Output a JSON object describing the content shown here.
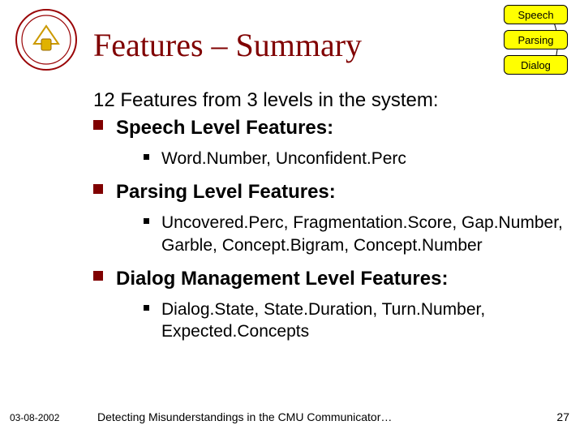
{
  "title": "Features – Summary",
  "tags": {
    "speech": "Speech",
    "parsing": "Parsing",
    "dialog": "Dialog"
  },
  "intro": "12 Features from 3 levels in the system:",
  "sections": [
    {
      "label": "Speech Level Features:",
      "items": [
        "Word.Number, Unconfident.Perc"
      ]
    },
    {
      "label": "Parsing Level Features:",
      "items": [
        "Uncovered.Perc, Fragmentation.Score, Gap.Number, Garble, Concept.Bigram, Concept.Number"
      ]
    },
    {
      "label": "Dialog Management Level Features:",
      "items": [
        "Dialog.State, State.Duration, Turn.Number, Expected.Concepts"
      ]
    }
  ],
  "footer": {
    "date": "03-08-2002",
    "title": "Detecting Misunderstandings in the CMU Communicator…",
    "page": "27"
  }
}
